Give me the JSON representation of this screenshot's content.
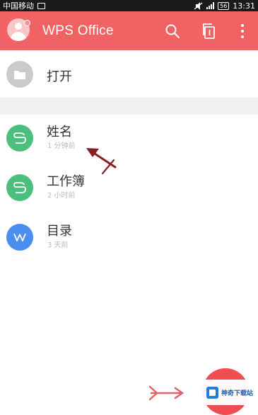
{
  "status_bar": {
    "carrier": "中国移动",
    "battery": "56",
    "time": "13:31"
  },
  "app_bar": {
    "title": "WPS Office",
    "icons": [
      "avatar",
      "search-icon",
      "copy-icon",
      "more-vert-icon"
    ]
  },
  "open_item": {
    "label": "打开",
    "icon": "folder-icon"
  },
  "files": [
    {
      "name": "姓名",
      "time": "1 分钟前",
      "type_letter": "S",
      "color": "#4cbf7c",
      "icon": "spreadsheet-icon"
    },
    {
      "name": "工作簿",
      "time": "2 小时前",
      "type_letter": "S",
      "color": "#4cbf7c",
      "icon": "spreadsheet-icon"
    },
    {
      "name": "目录",
      "time": "3 天前",
      "type_letter": "W",
      "color": "#4a8ef0",
      "icon": "document-icon"
    }
  ],
  "colors": {
    "accent": "#f06264",
    "fab": "#f04d50",
    "open_icon_bg": "#c9cacc"
  },
  "watermark": {
    "text": "神奇下载站"
  }
}
